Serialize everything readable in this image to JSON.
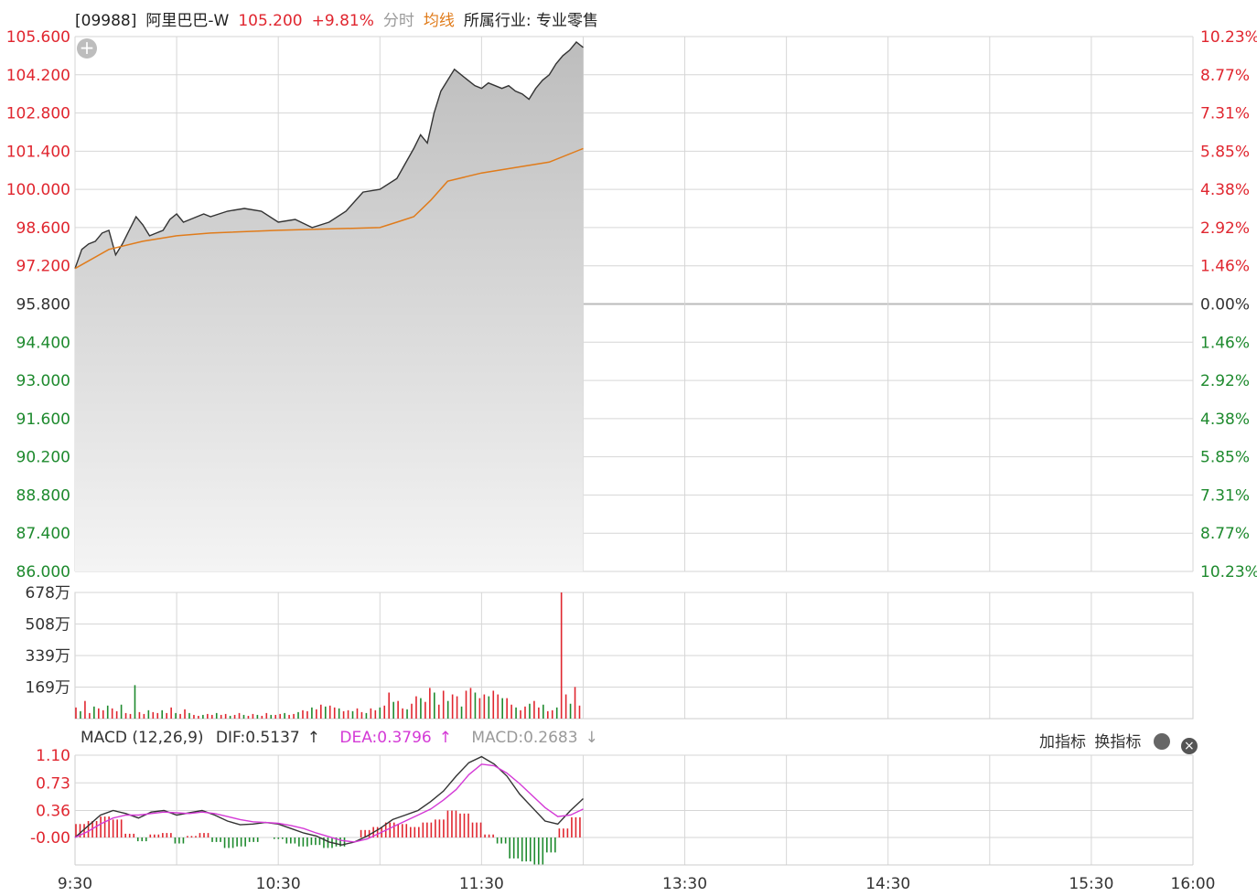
{
  "header": {
    "code": "[09988]",
    "name": "阿里巴巴-W",
    "price": "105.200",
    "change": "+9.81%",
    "mode": "分时",
    "avg_label": "均线",
    "industry": "所属行业: 专业零售"
  },
  "macd_header": {
    "title": "MACD (12,26,9)",
    "dif": "DIF:0.5137",
    "dif_arrow": "↑",
    "dea": "DEA:0.3796",
    "dea_arrow": "↑",
    "macd": "MACD:0.2683",
    "macd_arrow": "↓"
  },
  "tools": {
    "add": "加指标",
    "switch": "换指标"
  },
  "icons": {
    "add_indicator": "plus-circle-icon",
    "settings": "gear-icon",
    "close": "close-icon"
  },
  "colors": {
    "up": "#e0262f",
    "down": "#1e8a2e",
    "avg": "#e07b1a",
    "price": "#333333",
    "dea": "#d43ad6"
  },
  "chart_data": [
    {
      "type": "area",
      "series": [
        {
          "name": "",
          "x": [
            "9:30",
            "9:32",
            "9:34",
            "9:36",
            "9:38",
            "9:40",
            "9:42",
            "9:44",
            "9:46",
            "9:48",
            "9:50",
            "9:52",
            "9:54",
            "9:56",
            "9:58",
            "10:00",
            "10:02",
            "10:04",
            "10:06",
            "10:08",
            "10:10",
            "10:15",
            "10:20",
            "10:25",
            "10:30",
            "10:35",
            "10:40",
            "10:45",
            "10:50",
            "10:55",
            "11:00",
            "11:05",
            "11:10",
            "11:12",
            "11:14",
            "11:16",
            "11:18",
            "11:20",
            "11:22",
            "11:24",
            "11:26",
            "11:28",
            "11:30",
            "11:32",
            "11:34",
            "11:36",
            "11:38",
            "11:40",
            "11:42",
            "11:44",
            "11:46",
            "11:48",
            "11:50",
            "11:52",
            "11:54",
            "11:56",
            "11:58",
            "12:00"
          ],
          "values": [
            97.1,
            97.8,
            98.0,
            98.1,
            98.4,
            98.5,
            97.6,
            98.0,
            98.5,
            99.0,
            98.7,
            98.3,
            98.4,
            98.5,
            98.9,
            99.1,
            98.8,
            98.9,
            99.0,
            99.1,
            99.0,
            99.2,
            99.3,
            99.2,
            98.8,
            98.9,
            98.6,
            98.8,
            99.2,
            99.9,
            100.0,
            100.4,
            101.5,
            102.0,
            101.7,
            102.8,
            103.6,
            104.0,
            104.4,
            104.2,
            104.0,
            103.8,
            103.7,
            103.9,
            103.8,
            103.7,
            103.8,
            103.6,
            103.5,
            103.3,
            103.7,
            104.0,
            104.2,
            104.6,
            104.9,
            105.1,
            105.4,
            105.2
          ]
        },
        {
          "name": "",
          "x": [
            "9:30",
            "9:40",
            "9:50",
            "10:00",
            "10:10",
            "10:30",
            "11:00",
            "11:05",
            "11:10",
            "11:15",
            "11:20",
            "11:30",
            "11:40",
            "11:50",
            "12:00"
          ],
          "values": [
            97.1,
            97.8,
            98.1,
            98.3,
            98.4,
            98.5,
            98.6,
            98.8,
            99.0,
            99.6,
            100.3,
            100.6,
            100.8,
            101.0,
            101.5
          ]
        }
      ],
      "x_ticks": [
        "9:30",
        "10:30",
        "11:30",
        "13:30",
        "14:30",
        "15:30",
        "16:00"
      ],
      "y_ticks": [
        "105.600",
        "104.200",
        "102.800",
        "101.400",
        "100.000",
        "98.600",
        "97.200",
        "95.800",
        "94.400",
        "93.000",
        "91.600",
        "90.200",
        "88.800",
        "87.400",
        "86.000"
      ],
      "y_ticks_right": [
        "10.23%",
        "8.77%",
        "7.31%",
        "5.85%",
        "4.38%",
        "2.92%",
        "1.46%",
        "0.00%",
        "1.46%",
        "2.92%",
        "4.38%",
        "5.85%",
        "7.31%",
        "8.77%",
        "10.23%"
      ],
      "ylim": [
        86.0,
        105.6
      ],
      "grid": true
    },
    {
      "type": "bar",
      "y_ticks": [
        "678万",
        "508万",
        "339万",
        "169万"
      ],
      "ylim": [
        0,
        678
      ],
      "series": [
        {
          "name": "",
          "values": [
            60,
            40,
            95,
            30,
            65,
            55,
            45,
            70,
            55,
            40,
            75,
            30,
            25,
            180,
            35,
            25,
            45,
            35,
            30,
            45,
            30,
            60,
            30,
            25,
            50,
            30,
            20,
            15,
            20,
            25,
            20,
            30,
            20,
            25,
            15,
            20,
            30,
            20,
            15,
            25,
            20,
            15,
            30,
            20,
            20,
            25,
            30,
            20,
            25,
            35,
            45,
            40,
            60,
            50,
            75,
            65,
            70,
            60,
            55,
            40,
            45,
            40,
            55,
            35,
            30,
            55,
            45,
            60,
            70,
            140,
            90,
            95,
            55,
            50,
            80,
            120,
            110,
            90,
            165,
            140,
            75,
            150,
            95,
            130,
            120,
            65,
            150,
            165,
            140,
            110,
            130,
            120,
            150,
            130,
            110,
            110,
            75,
            60,
            45,
            65,
            80,
            95,
            60,
            75,
            40,
            45,
            60,
            678,
            130,
            80,
            170,
            70
          ]
        }
      ],
      "colors_per_bar": "up-red/down-green"
    },
    {
      "type": "line",
      "y_ticks": [
        "1.10",
        "0.73",
        "0.36",
        "-0.00"
      ],
      "ylim": [
        0,
        1.1
      ],
      "series": [
        {
          "name": "DIF",
          "values": [
            0.0,
            0.15,
            0.3,
            0.36,
            0.32,
            0.26,
            0.34,
            0.36,
            0.3,
            0.33,
            0.36,
            0.3,
            0.22,
            0.17,
            0.18,
            0.2,
            0.18,
            0.12,
            0.06,
            0.02,
            -0.06,
            -0.1,
            -0.06,
            0.02,
            0.12,
            0.24,
            0.3,
            0.36,
            0.48,
            0.62,
            0.82,
            1.0,
            1.08,
            0.98,
            0.82,
            0.58,
            0.4,
            0.22,
            0.18,
            0.36,
            0.52
          ]
        },
        {
          "name": "DEA",
          "values": [
            0.0,
            0.08,
            0.18,
            0.26,
            0.3,
            0.3,
            0.32,
            0.34,
            0.33,
            0.32,
            0.34,
            0.32,
            0.28,
            0.24,
            0.21,
            0.2,
            0.19,
            0.16,
            0.12,
            0.06,
            0.01,
            -0.04,
            -0.06,
            -0.02,
            0.06,
            0.14,
            0.22,
            0.3,
            0.38,
            0.5,
            0.64,
            0.84,
            0.98,
            0.96,
            0.86,
            0.72,
            0.56,
            0.4,
            0.28,
            0.3,
            0.38
          ]
        }
      ],
      "histogram": [
        0.18,
        0.22,
        0.28,
        0.24,
        0.05,
        -0.05,
        0.04,
        0.06,
        -0.08,
        0.02,
        0.06,
        -0.06,
        -0.14,
        -0.12,
        -0.06,
        0.0,
        -0.02,
        -0.08,
        -0.12,
        -0.1,
        -0.14,
        -0.12,
        0.0,
        0.1,
        0.14,
        0.2,
        0.18,
        0.14,
        0.2,
        0.24,
        0.36,
        0.32,
        0.2,
        0.04,
        -0.08,
        -0.28,
        -0.32,
        -0.36,
        -0.2,
        0.12,
        0.27
      ]
    }
  ]
}
